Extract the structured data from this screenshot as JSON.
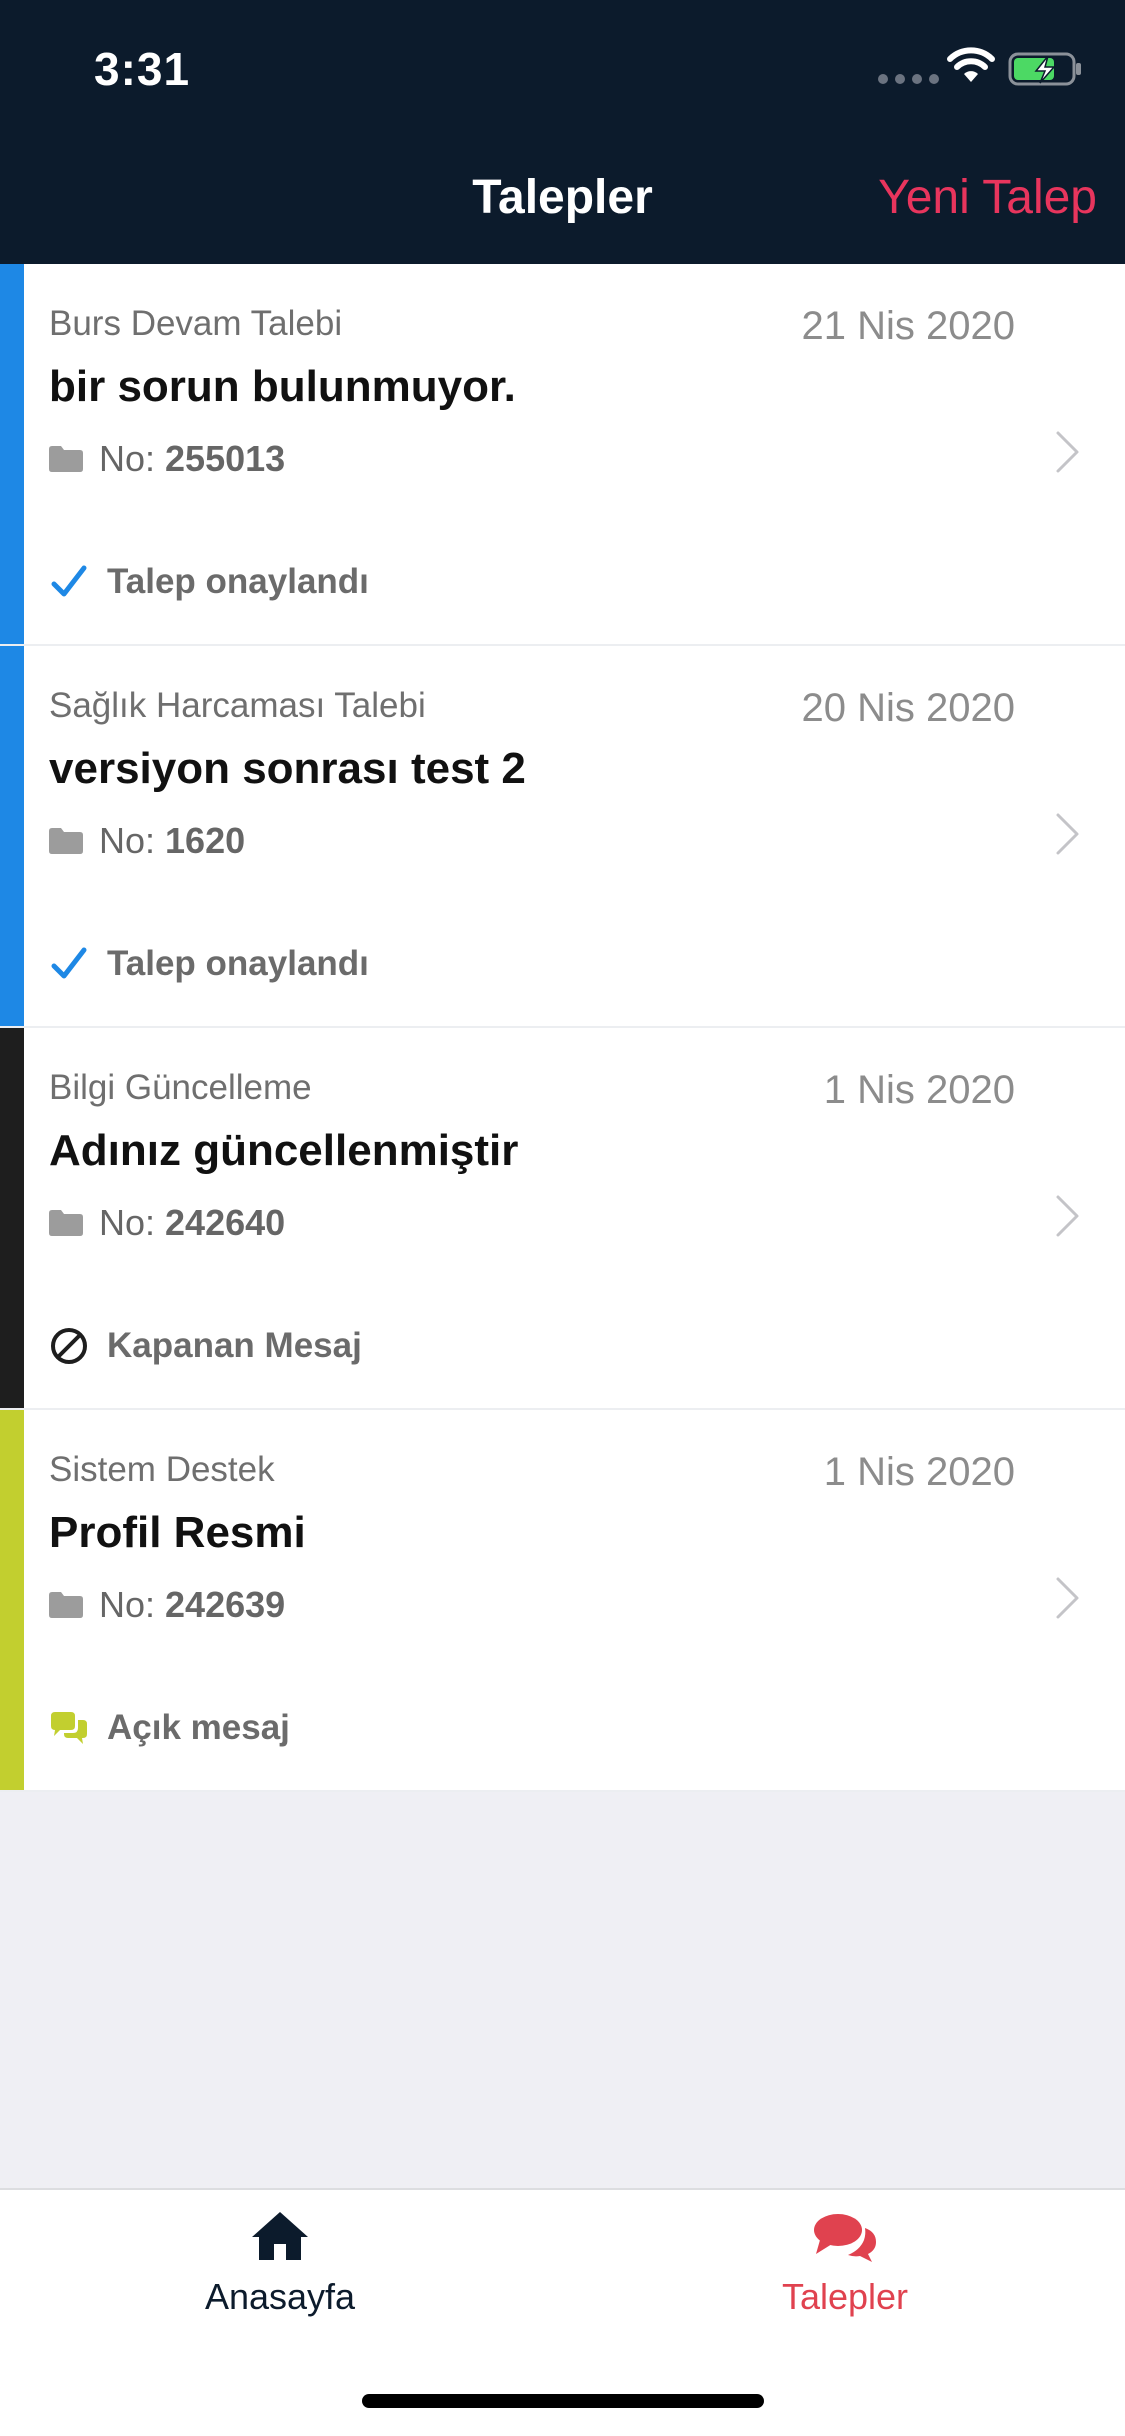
{
  "status_bar": {
    "time": "3:31"
  },
  "nav": {
    "title": "Talepler",
    "action_label": "Yeni Talep"
  },
  "items": [
    {
      "category": "Burs Devam Talebi",
      "date": "21 Nis 2020",
      "title": "bir sorun bulunmuyor.",
      "number_label": "No:",
      "number": "255013",
      "status": "Talep onaylandı",
      "bar_color": "#1e88e5"
    },
    {
      "category": "Sağlık Harcaması Talebi",
      "date": "20 Nis 2020",
      "title": "versiyon sonrası test 2",
      "number_label": "No:",
      "number": "1620",
      "status": "Talep onaylandı",
      "bar_color": "#1e88e5"
    },
    {
      "category": "Bilgi Güncelleme",
      "date": "1 Nis 2020",
      "title": "Adınız güncellenmiştir",
      "number_label": "No:",
      "number": "242640",
      "status": "Kapanan Mesaj",
      "bar_color": "#1e1e1e"
    },
    {
      "category": "Sistem Destek",
      "date": "1 Nis 2020",
      "title": "Profil Resmi",
      "number_label": "No:",
      "number": "242639",
      "status": "Açık mesaj",
      "bar_color": "#c2cf2f"
    }
  ],
  "tabbar": {
    "home_label": "Anasayfa",
    "requests_label": "Talepler"
  },
  "colors": {
    "header_bg": "#0c1b2c",
    "accent": "#e8355d",
    "approved_blue": "#1e88e5",
    "open_green": "#c2cf2f"
  }
}
